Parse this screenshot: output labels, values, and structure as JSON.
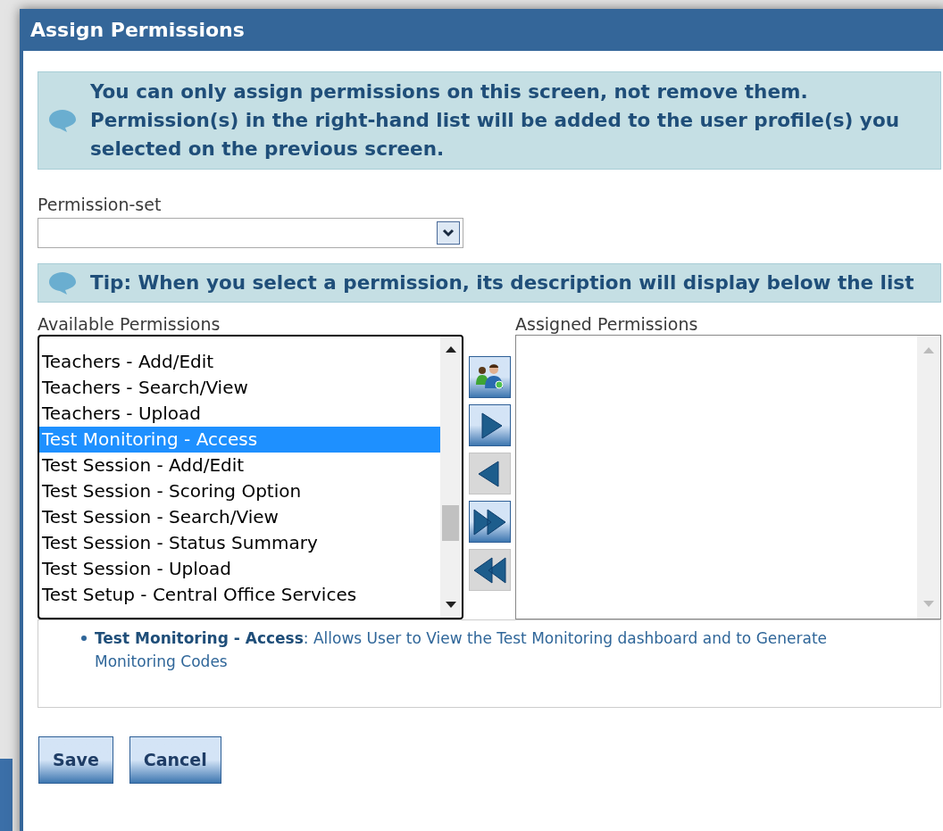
{
  "window": {
    "title": "Assign Permissions"
  },
  "notice": "You can only assign permissions on this screen, not remove them. Permission(s) in the right-hand list will be added to the user profile(s) you selected on the previous screen.",
  "permission_set": {
    "label": "Permission-set"
  },
  "tip": "Tip: When you select a permission, its description will display below the list",
  "available": {
    "label": "Available Permissions",
    "items": [
      {
        "label": "Teachers - Add/Edit",
        "selected": false
      },
      {
        "label": "Teachers - Search/View",
        "selected": false
      },
      {
        "label": "Teachers - Upload",
        "selected": false
      },
      {
        "label": "Test Monitoring - Access",
        "selected": true
      },
      {
        "label": "Test Session - Add/Edit",
        "selected": false
      },
      {
        "label": "Test Session - Scoring Option",
        "selected": false
      },
      {
        "label": "Test Session - Search/View",
        "selected": false
      },
      {
        "label": "Test Session - Status Summary",
        "selected": false
      },
      {
        "label": "Test Session - Upload",
        "selected": false
      },
      {
        "label": "Test Setup - Central Office Services",
        "selected": false
      }
    ]
  },
  "move_buttons": [
    {
      "kind": "people",
      "disabled": false
    },
    {
      "kind": "right",
      "disabled": false
    },
    {
      "kind": "left",
      "disabled": true
    },
    {
      "kind": "all-right",
      "disabled": false
    },
    {
      "kind": "all-left",
      "disabled": true
    }
  ],
  "assigned": {
    "label": "Assigned Permissions"
  },
  "description": "**Test Monitoring - Access**: Allows User to View the Test Monitoring dashboard and to Generate Monitoring Codes",
  "buttons": [
    "Save",
    "Cancel"
  ]
}
